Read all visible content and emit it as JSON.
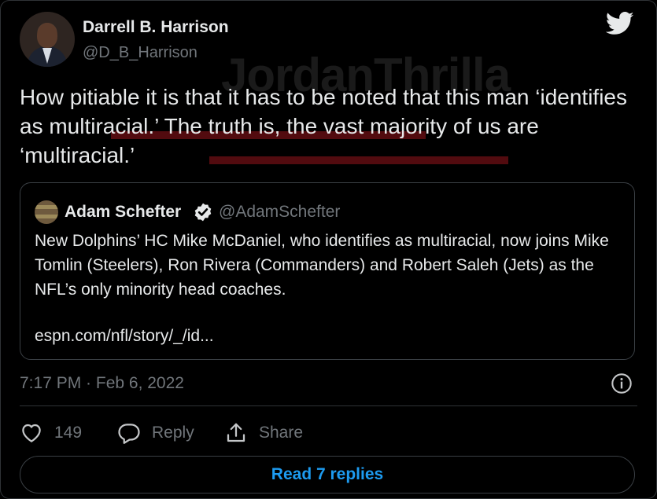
{
  "tweet": {
    "author_name": "Darrell B. Harrison",
    "author_handle": "@D_B_Harrison",
    "text": "How pitiable it is that it has to be noted that this man ‘identifies as multiracial.’ The truth is, the vast majority of us are ‘multiracial.’",
    "timestamp": "7:17 PM · Feb 6, 2022",
    "watermark": "JordanThrilla",
    "brand_icon": "twitter-bird-icon",
    "accent_color": "#1d9bf0"
  },
  "quoted": {
    "author_name": "Adam Schefter",
    "author_handle": "@AdamSchefter",
    "text": "New Dolphins’ HC Mike McDaniel, who identifies as multiracial, now joins Mike Tomlin (Steelers), Ron Rivera (Commanders) and Robert Saleh (Jets) as the NFL’s only minority head coaches.",
    "link": "espn.com/nfl/story/_/id..."
  },
  "actions": {
    "like_count": "149",
    "reply_label": "Reply",
    "share_label": "Share"
  },
  "read_replies_label": "Read 7 replies"
}
